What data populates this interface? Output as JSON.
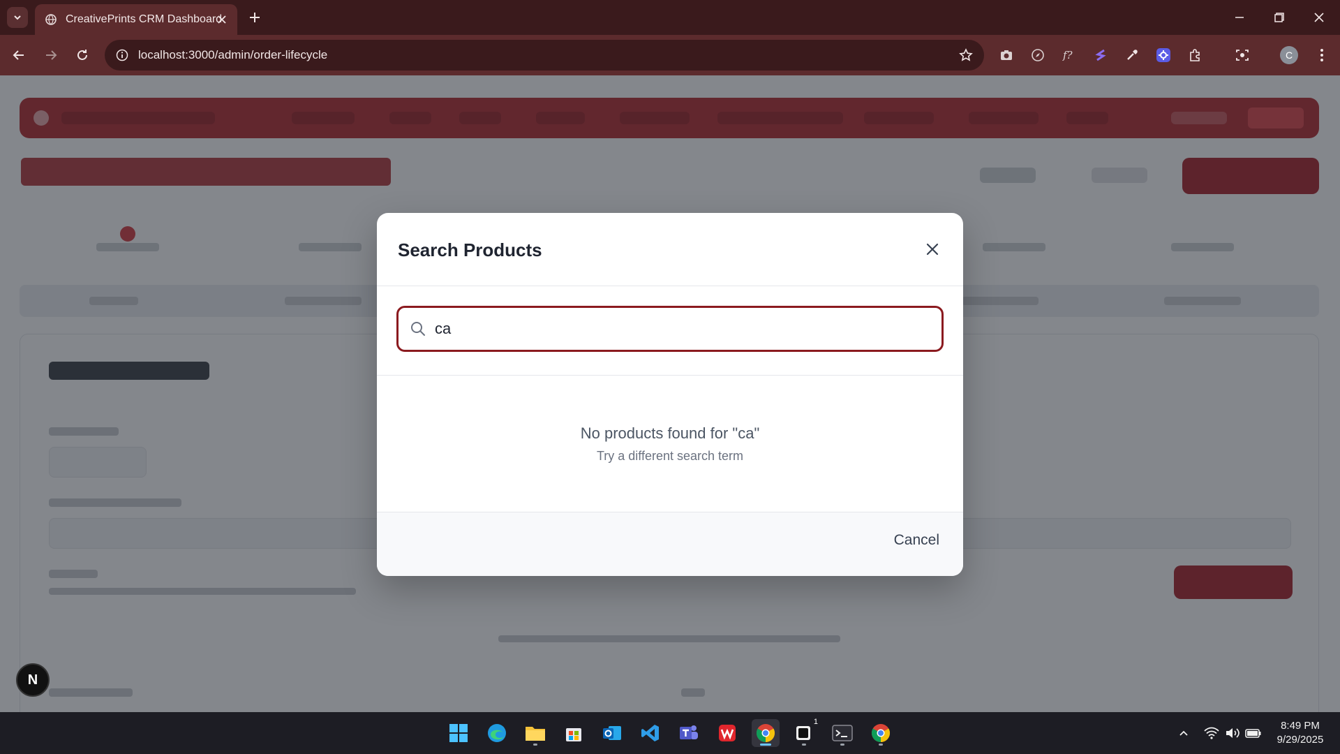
{
  "browser": {
    "tab_title": "CreativePrints CRM Dashboard",
    "url": "localhost:3000/admin/order-lifecycle",
    "profile_initial": "C"
  },
  "modal": {
    "title": "Search Products",
    "search": {
      "value": "ca",
      "placeholder": "Search products..."
    },
    "empty_title": "No products found for \"ca\"",
    "empty_subtitle": "Try a different search term",
    "cancel_label": "Cancel"
  },
  "nextjs_badge": "N",
  "taskbar": {
    "time": "8:49 PM",
    "date": "9/29/2025",
    "terminal_badge": "1"
  },
  "colors": {
    "brand_red": "#8b1a1f",
    "chrome_dark": "#3a1a1c",
    "chrome_toolbar": "#5c2b2d"
  }
}
